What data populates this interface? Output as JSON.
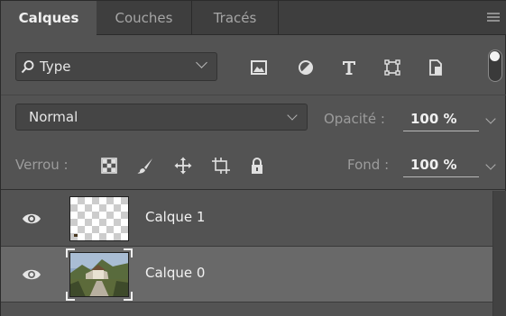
{
  "tabs": [
    {
      "label": "Calques",
      "active": true
    },
    {
      "label": "Couches",
      "active": false
    },
    {
      "label": "Tracés",
      "active": false
    }
  ],
  "filter": {
    "label": "Type",
    "icons": [
      "image-filter-icon",
      "adjustment-filter-icon",
      "type-filter-icon",
      "shape-filter-icon",
      "smart-object-filter-icon"
    ],
    "toggle_on": true
  },
  "blend": {
    "mode": "Normal",
    "opacity_label": "Opacité :",
    "opacity_value": "100 %"
  },
  "lock": {
    "label": "Verrou :",
    "icons": [
      "lock-transparent-pixels-icon",
      "lock-image-pixels-icon",
      "lock-position-icon",
      "lock-artboard-icon",
      "lock-all-icon"
    ],
    "fill_label": "Fond :",
    "fill_value": "100 %"
  },
  "layers": [
    {
      "name": "Calque 1",
      "visible": true,
      "selected": false,
      "thumbnail": "transparent-checker"
    },
    {
      "name": "Calque 0",
      "visible": true,
      "selected": true,
      "thumbnail": "photo"
    }
  ],
  "colors": {
    "panel_bg": "#535353",
    "tab_bar_bg": "#3e3e3e",
    "selected_row": "#696969",
    "text": "#d6d6d6"
  }
}
